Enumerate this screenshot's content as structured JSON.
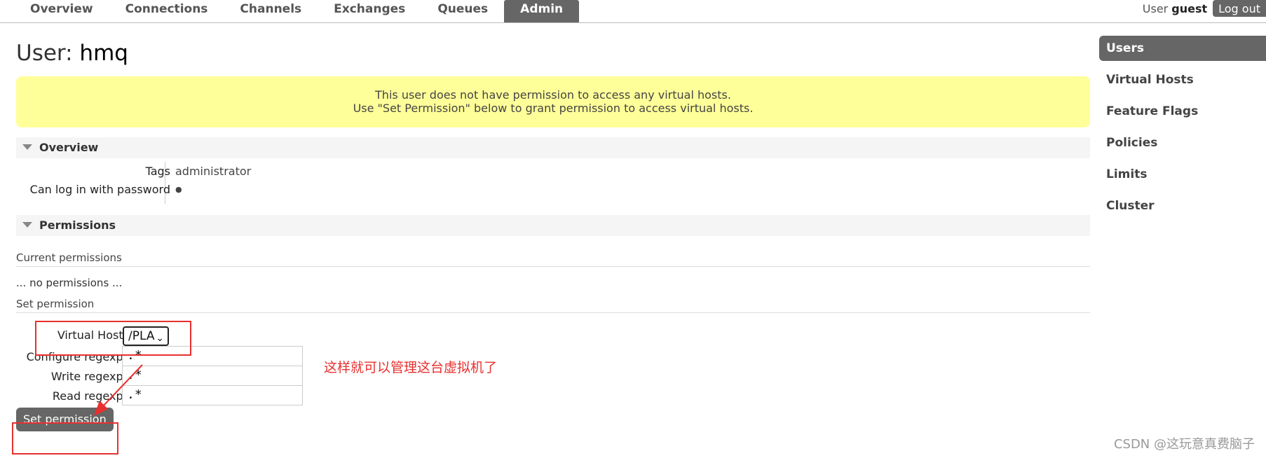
{
  "nav": {
    "tabs": [
      "Overview",
      "Connections",
      "Channels",
      "Exchanges",
      "Queues",
      "Admin"
    ],
    "active_tab": "Admin",
    "user_label": "User",
    "user_name": "guest",
    "logout_label": "Log out"
  },
  "page": {
    "title_prefix": "User:",
    "title_name": "hmq",
    "warning_line1": "This user does not have permission to access any virtual hosts.",
    "warning_line2": "Use \"Set Permission\" below to grant permission to access virtual hosts."
  },
  "overview": {
    "heading": "Overview",
    "tags_label": "Tags",
    "tags_value": "administrator",
    "login_label": "Can log in with password",
    "login_value": "●"
  },
  "permissions": {
    "heading": "Permissions",
    "current_heading": "Current permissions",
    "no_permissions": "... no permissions ...",
    "set_heading": "Set permission",
    "vhost_label": "Virtual Host:",
    "vhost_value": "/PLA",
    "configure_label": "Configure regexp:",
    "configure_value": ".*",
    "write_label": "Write regexp:",
    "write_value": ".*",
    "read_label": "Read regexp:",
    "read_value": ".*",
    "submit_label": "Set permission"
  },
  "annotation": "这样就可以管理这台虚拟机了",
  "sidebar": {
    "items": [
      "Users",
      "Virtual Hosts",
      "Feature Flags",
      "Policies",
      "Limits",
      "Cluster"
    ],
    "active": "Users"
  },
  "watermark": "CSDN @这玩意真费脑子",
  "colors": {
    "accent_gray": "#666666",
    "warning_bg": "#ffff99",
    "annotation_red": "#e8302f"
  }
}
